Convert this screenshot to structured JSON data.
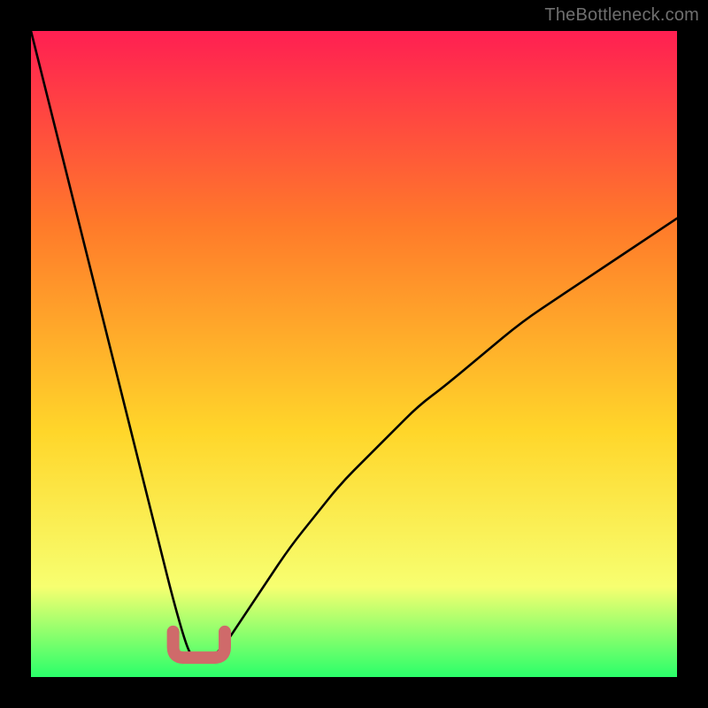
{
  "watermark": {
    "text": "TheBottleneck.com"
  },
  "colors": {
    "background": "#000000",
    "gradient_top": "#ff1f52",
    "gradient_mid_upper": "#ff7a2a",
    "gradient_mid": "#ffd62a",
    "gradient_mid_lower": "#f7ff70",
    "gradient_bottom": "#2aff6a",
    "curve": "#000000",
    "marker": "#cf6a6a"
  },
  "chart_data": {
    "type": "line",
    "title": "",
    "xlabel": "",
    "ylabel": "",
    "xlim": [
      0,
      100
    ],
    "ylim": [
      0,
      100
    ],
    "grid": false,
    "legend": false,
    "series": [
      {
        "name": "bottleneck-curve",
        "x": [
          0,
          2,
          4,
          6,
          8,
          10,
          12,
          14,
          16,
          18,
          20,
          22,
          24,
          25,
          26,
          27,
          28,
          30,
          32,
          36,
          40,
          44,
          48,
          52,
          56,
          60,
          64,
          70,
          76,
          82,
          88,
          94,
          100
        ],
        "y": [
          100,
          92,
          84,
          76,
          68,
          60,
          52,
          44,
          36,
          28,
          20,
          12,
          5,
          3,
          2.5,
          2.5,
          3,
          5,
          8,
          14,
          20,
          25,
          30,
          34,
          38,
          42,
          45,
          50,
          55,
          59,
          63,
          67,
          71
        ]
      }
    ],
    "annotations": [
      {
        "name": "valley-marker",
        "shape": "u",
        "x_range": [
          22,
          30
        ],
        "y": 3,
        "color": "#cf6a6a"
      }
    ]
  }
}
